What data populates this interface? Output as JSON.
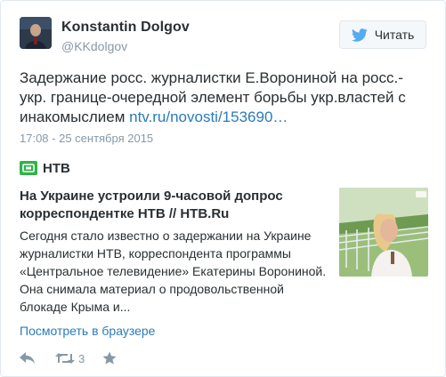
{
  "user": {
    "name": "Konstantin Dolgov",
    "handle": "@KKdolgov"
  },
  "follow_button": {
    "label": "Читать",
    "icon": "twitter-bird-icon"
  },
  "tweet": {
    "text": "Задержание росс. журналистки Е.Ворониной на росс.-укр. границе-очередной элемент  борьбы укр.властей с инакомыслием ",
    "link": "ntv.ru/novosti/153690…",
    "timestamp": "17:08 - 25 сентября 2015"
  },
  "card": {
    "source_name": "НТВ",
    "source_icon": "ntv-logo-icon",
    "title": "На Украине устроили 9-часовой допрос корреспондентке НТВ // НТВ.Ru",
    "description": "Сегодня стало известно о задержании на Украине журналистки НТВ, корреспондента программы «Центральное телевидение» Екатерины Ворониной. Она снимала материал о продовольственной блокаде Крыма и..."
  },
  "view_in_browser": "Посмотреть в браузере",
  "actions": {
    "reply_icon": "reply-icon",
    "retweet_icon": "retweet-icon",
    "retweet_count": "3",
    "like_icon": "star-icon"
  },
  "colors": {
    "link": "#2b7bb9",
    "muted": "#8899a6",
    "text": "#292f33",
    "brand_green": "#2fb34a",
    "twitter_blue": "#55acee"
  }
}
